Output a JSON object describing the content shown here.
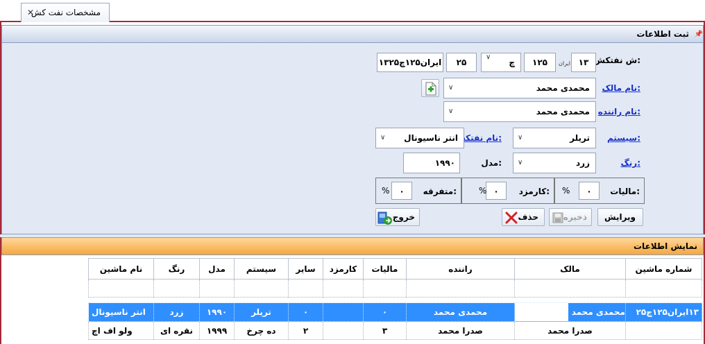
{
  "tab": {
    "label": "مشخصات نفت کش",
    "close": "✕"
  },
  "form": {
    "title": "ثبت اطلاعات",
    "plate": {
      "label": "ش نفتکش:",
      "code": "۱۳",
      "iran": "ایران",
      "three": "۱۲۵",
      "letter": "چ",
      "two": "۲۵",
      "full": "۱۳ایران۱۲۵چ۲۵"
    },
    "owner": {
      "label": "نام مالک:",
      "value": "محمدی محمد"
    },
    "driver": {
      "label": "نام راننده:",
      "value": "محمدی محمد"
    },
    "system": {
      "label": "سیستم:",
      "value": "تریلر"
    },
    "tanker_name": {
      "label": "نام نفتکش:",
      "value": "انتر ناسیونال"
    },
    "color": {
      "label": "رنگ:",
      "value": "زرد"
    },
    "model": {
      "label": "مدل:",
      "value": "۱۹۹۰"
    },
    "tax": {
      "label": "مالیات:",
      "value": "۰",
      "unit": "%"
    },
    "commission": {
      "label": "کارمزد:",
      "value": "۰",
      "unit": "%"
    },
    "misc": {
      "label": "متفرقه:",
      "value": "۰",
      "unit": "%"
    },
    "buttons": {
      "edit": "ویرایش",
      "save": "ذخیره",
      "delete": "حذف",
      "exit": "خروج"
    }
  },
  "display": {
    "title": "نمایش اطلاعات",
    "columns": [
      "شماره ماشین",
      "مالک",
      "راننده",
      "مالیات",
      "کارمزد",
      "سایر",
      "سیستم",
      "مدل",
      "رنگ",
      "نام ماشین"
    ],
    "rows": [
      [
        "۱۳ایران۱۲۵چ۲۵",
        "محمدی محمد",
        "محمدی محمد",
        "۰",
        "",
        "۰",
        "تریلر",
        "۱۹۹۰",
        "زرد",
        "انتر ناسیونال"
      ],
      [
        "",
        "صدرا محمد",
        "صدرا محمد",
        "۳",
        "",
        "۲",
        "ده چرخ",
        "۱۹۹۹",
        "نقره ای",
        "ولو اف اچ"
      ]
    ]
  },
  "colors": {
    "accent": "#a42a3a",
    "header_orange": "#f4a83f",
    "selected_row": "#2f8fff",
    "link": "#1530c8"
  }
}
